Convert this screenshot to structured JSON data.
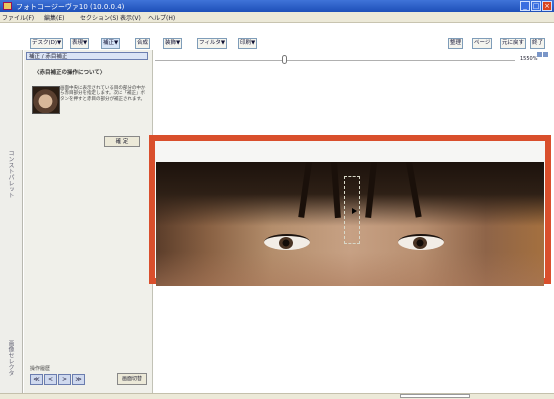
{
  "window": {
    "title": "フォトコージーヴァ10 (10.0.0.4)",
    "buttons": [
      "_",
      "□",
      "×"
    ]
  },
  "menu": [
    "ファイル(F)",
    "編集(E)",
    "セクション(S)",
    "表示(V)",
    "ヘルプ(H)"
  ],
  "toolbar": [
    "デスク(D)▼",
    "表現▼",
    "補正▼",
    "合成",
    "装飾▼",
    "フィルタ▼",
    "印刷▼"
  ],
  "toolbar_right": [
    "整理",
    "ページ",
    "元に戻す",
    "終了"
  ],
  "sidebar": {
    "palette_label": "コンストパレット",
    "bottom_label": "画像セレクタ"
  },
  "panel": {
    "title": "補正 / 赤目補正",
    "heading": "〈赤目補正の操作について〉",
    "description": "画面中央に表示されている目の部分の中から赤目部分を指定します。次に「補正」ボタンを押すと赤目の部分が補正されます。",
    "ok_label": "確 定",
    "nav_label": "操作履歴",
    "nav_buttons": [
      "≪",
      "<",
      ">",
      "≫"
    ],
    "switch_label": "画面切替"
  },
  "zoom": {
    "label": "1550%",
    "value": 1550
  },
  "accent_color": "#d94f2c"
}
